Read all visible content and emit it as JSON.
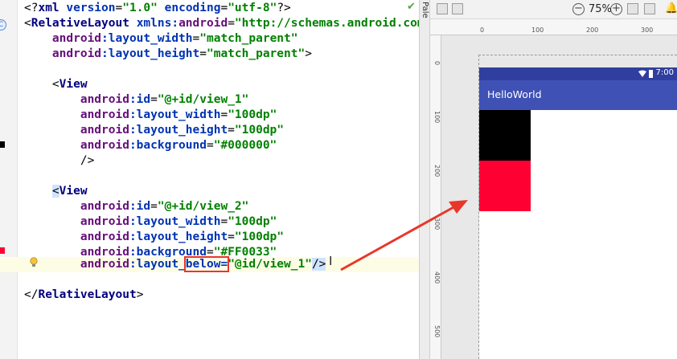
{
  "editor": {
    "lines": [
      {
        "id": "l1",
        "parts": [
          [
            "plain",
            "<?"
          ],
          [
            "tag",
            "xml "
          ],
          [
            "ns",
            "version"
          ],
          [
            "plain",
            "="
          ],
          [
            "val",
            "\"1.0\""
          ],
          [
            "plain",
            " "
          ],
          [
            "ns",
            "encoding"
          ],
          [
            "plain",
            "="
          ],
          [
            "val",
            "\"utf-8\""
          ],
          [
            "plain",
            "?>"
          ]
        ]
      },
      {
        "id": "l2",
        "parts": [
          [
            "plain",
            "<"
          ],
          [
            "tag",
            "RelativeLayout "
          ],
          [
            "ns",
            "xmlns:"
          ],
          [
            "attr",
            "android"
          ],
          [
            "plain",
            "="
          ],
          [
            "val",
            "\"http://schemas.android.com/"
          ]
        ]
      },
      {
        "id": "l3",
        "parts": [
          [
            "plain",
            "    "
          ],
          [
            "attr",
            "android"
          ],
          [
            "ns",
            ":layout_width"
          ],
          [
            "plain",
            "="
          ],
          [
            "val",
            "\"match_parent\""
          ]
        ]
      },
      {
        "id": "l4",
        "parts": [
          [
            "plain",
            "    "
          ],
          [
            "attr",
            "android"
          ],
          [
            "ns",
            ":layout_height"
          ],
          [
            "plain",
            "="
          ],
          [
            "val",
            "\"match_parent\""
          ],
          [
            "plain",
            ">"
          ]
        ]
      },
      {
        "id": "l5",
        "parts": []
      },
      {
        "id": "l6",
        "parts": [
          [
            "plain",
            "    <"
          ],
          [
            "tag",
            "View"
          ]
        ]
      },
      {
        "id": "l7",
        "parts": [
          [
            "plain",
            "        "
          ],
          [
            "attr",
            "android"
          ],
          [
            "ns",
            ":id"
          ],
          [
            "plain",
            "="
          ],
          [
            "val",
            "\"@+id/view_1\""
          ]
        ]
      },
      {
        "id": "l8",
        "parts": [
          [
            "plain",
            "        "
          ],
          [
            "attr",
            "android"
          ],
          [
            "ns",
            ":layout_width"
          ],
          [
            "plain",
            "="
          ],
          [
            "val",
            "\"100dp\""
          ]
        ]
      },
      {
        "id": "l9",
        "parts": [
          [
            "plain",
            "        "
          ],
          [
            "attr",
            "android"
          ],
          [
            "ns",
            ":layout_height"
          ],
          [
            "plain",
            "="
          ],
          [
            "val",
            "\"100dp\""
          ]
        ]
      },
      {
        "id": "l10",
        "parts": [
          [
            "plain",
            "        "
          ],
          [
            "attr",
            "android"
          ],
          [
            "ns",
            ":background"
          ],
          [
            "plain",
            "="
          ],
          [
            "val",
            "\"#000000\""
          ]
        ]
      },
      {
        "id": "l11",
        "parts": [
          [
            "plain",
            "        />"
          ]
        ]
      },
      {
        "id": "l12",
        "parts": []
      },
      {
        "id": "l13",
        "parts": [
          [
            "plain",
            "    "
          ],
          [
            "selplain",
            "<"
          ],
          [
            "tag",
            "View"
          ]
        ]
      },
      {
        "id": "l14",
        "parts": [
          [
            "plain",
            "        "
          ],
          [
            "attr",
            "android"
          ],
          [
            "ns",
            ":id"
          ],
          [
            "plain",
            "="
          ],
          [
            "val",
            "\"@+id/view_2\""
          ]
        ]
      },
      {
        "id": "l15",
        "parts": [
          [
            "plain",
            "        "
          ],
          [
            "attr",
            "android"
          ],
          [
            "ns",
            ":layout_width"
          ],
          [
            "plain",
            "="
          ],
          [
            "val",
            "\"100dp\""
          ]
        ]
      },
      {
        "id": "l16",
        "parts": [
          [
            "plain",
            "        "
          ],
          [
            "attr",
            "android"
          ],
          [
            "ns",
            ":layout_height"
          ],
          [
            "plain",
            "="
          ],
          [
            "val",
            "\"100dp\""
          ]
        ]
      },
      {
        "id": "l17",
        "parts": [
          [
            "plain",
            "        "
          ],
          [
            "attr",
            "android"
          ],
          [
            "ns",
            ":background"
          ],
          [
            "plain",
            "="
          ],
          [
            "val",
            "\"#FF0033\""
          ]
        ]
      },
      {
        "id": "l18",
        "hl": true,
        "parts": [
          [
            "plain",
            "        "
          ],
          [
            "attr",
            "android"
          ],
          [
            "ns",
            ":layout_"
          ],
          [
            "boxed",
            "below="
          ],
          [
            "val",
            "\"@id/view_1\""
          ],
          [
            "sel",
            "/>"
          ]
        ]
      },
      {
        "id": "l19",
        "parts": []
      },
      {
        "id": "l20",
        "parts": [
          [
            "plain",
            "</"
          ],
          [
            "tag",
            "RelativeLayout"
          ],
          [
            "plain",
            ">"
          ]
        ]
      }
    ]
  },
  "palette": {
    "label": "Pale"
  },
  "design_toolbar": {
    "zoom": "75%"
  },
  "ruler": {
    "top_ticks": [
      "0",
      "100",
      "200",
      "300"
    ],
    "left_ticks": [
      "0",
      "100",
      "200",
      "300",
      "400",
      "500"
    ]
  },
  "device": {
    "time": "7:00",
    "app_title": "HelloWorld",
    "view_1_color": "#000000",
    "view_2_color": "#FF0033",
    "statusbar_color": "#303f9f",
    "actionbar_color": "#3f51b5"
  },
  "annotation": {
    "arrow_color": "#e8372a"
  }
}
